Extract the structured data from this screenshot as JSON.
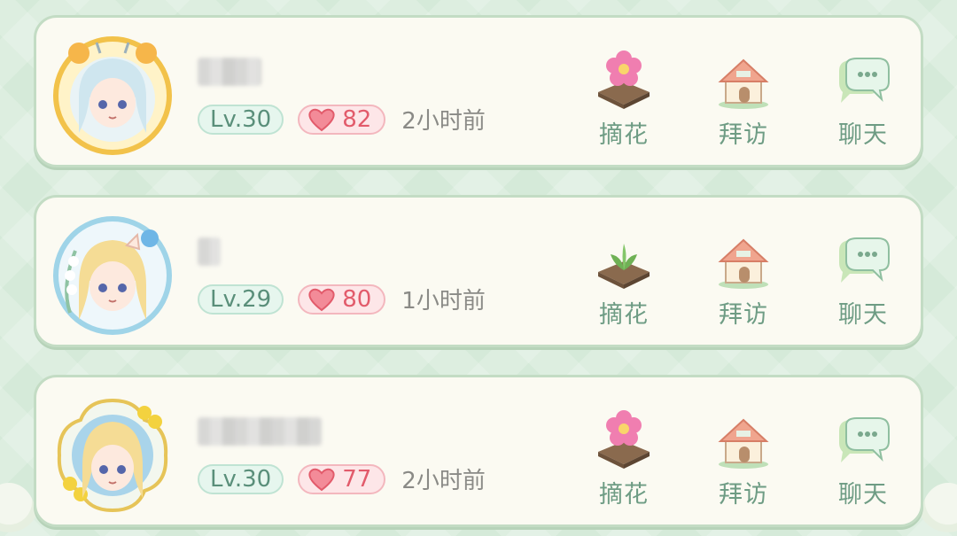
{
  "friends": [
    {
      "level": "Lv.30",
      "likes": "82",
      "last_seen": "2小时前",
      "plot": "flower",
      "actions": {
        "pick": "摘花",
        "visit": "拜访",
        "chat": "聊天"
      }
    },
    {
      "level": "Lv.29",
      "likes": "80",
      "last_seen": "1小时前",
      "plot": "sprout",
      "actions": {
        "pick": "摘花",
        "visit": "拜访",
        "chat": "聊天"
      }
    },
    {
      "level": "Lv.30",
      "likes": "77",
      "last_seen": "2小时前",
      "plot": "flower",
      "actions": {
        "pick": "摘花",
        "visit": "拜访",
        "chat": "聊天"
      }
    }
  ],
  "icons": {
    "pick": [
      "flower-plot-icon",
      "sprout-plot-icon",
      "flower-plot-icon"
    ],
    "visit": "house-icon",
    "chat": "chat-bubble-icon",
    "like": "heart-icon"
  },
  "colors": {
    "card_bg": "#fbfaf2",
    "card_border": "#c3dcc4",
    "level": "#5a8f7a",
    "likes": "#e25b6b",
    "action_label": "#6e9c84"
  }
}
